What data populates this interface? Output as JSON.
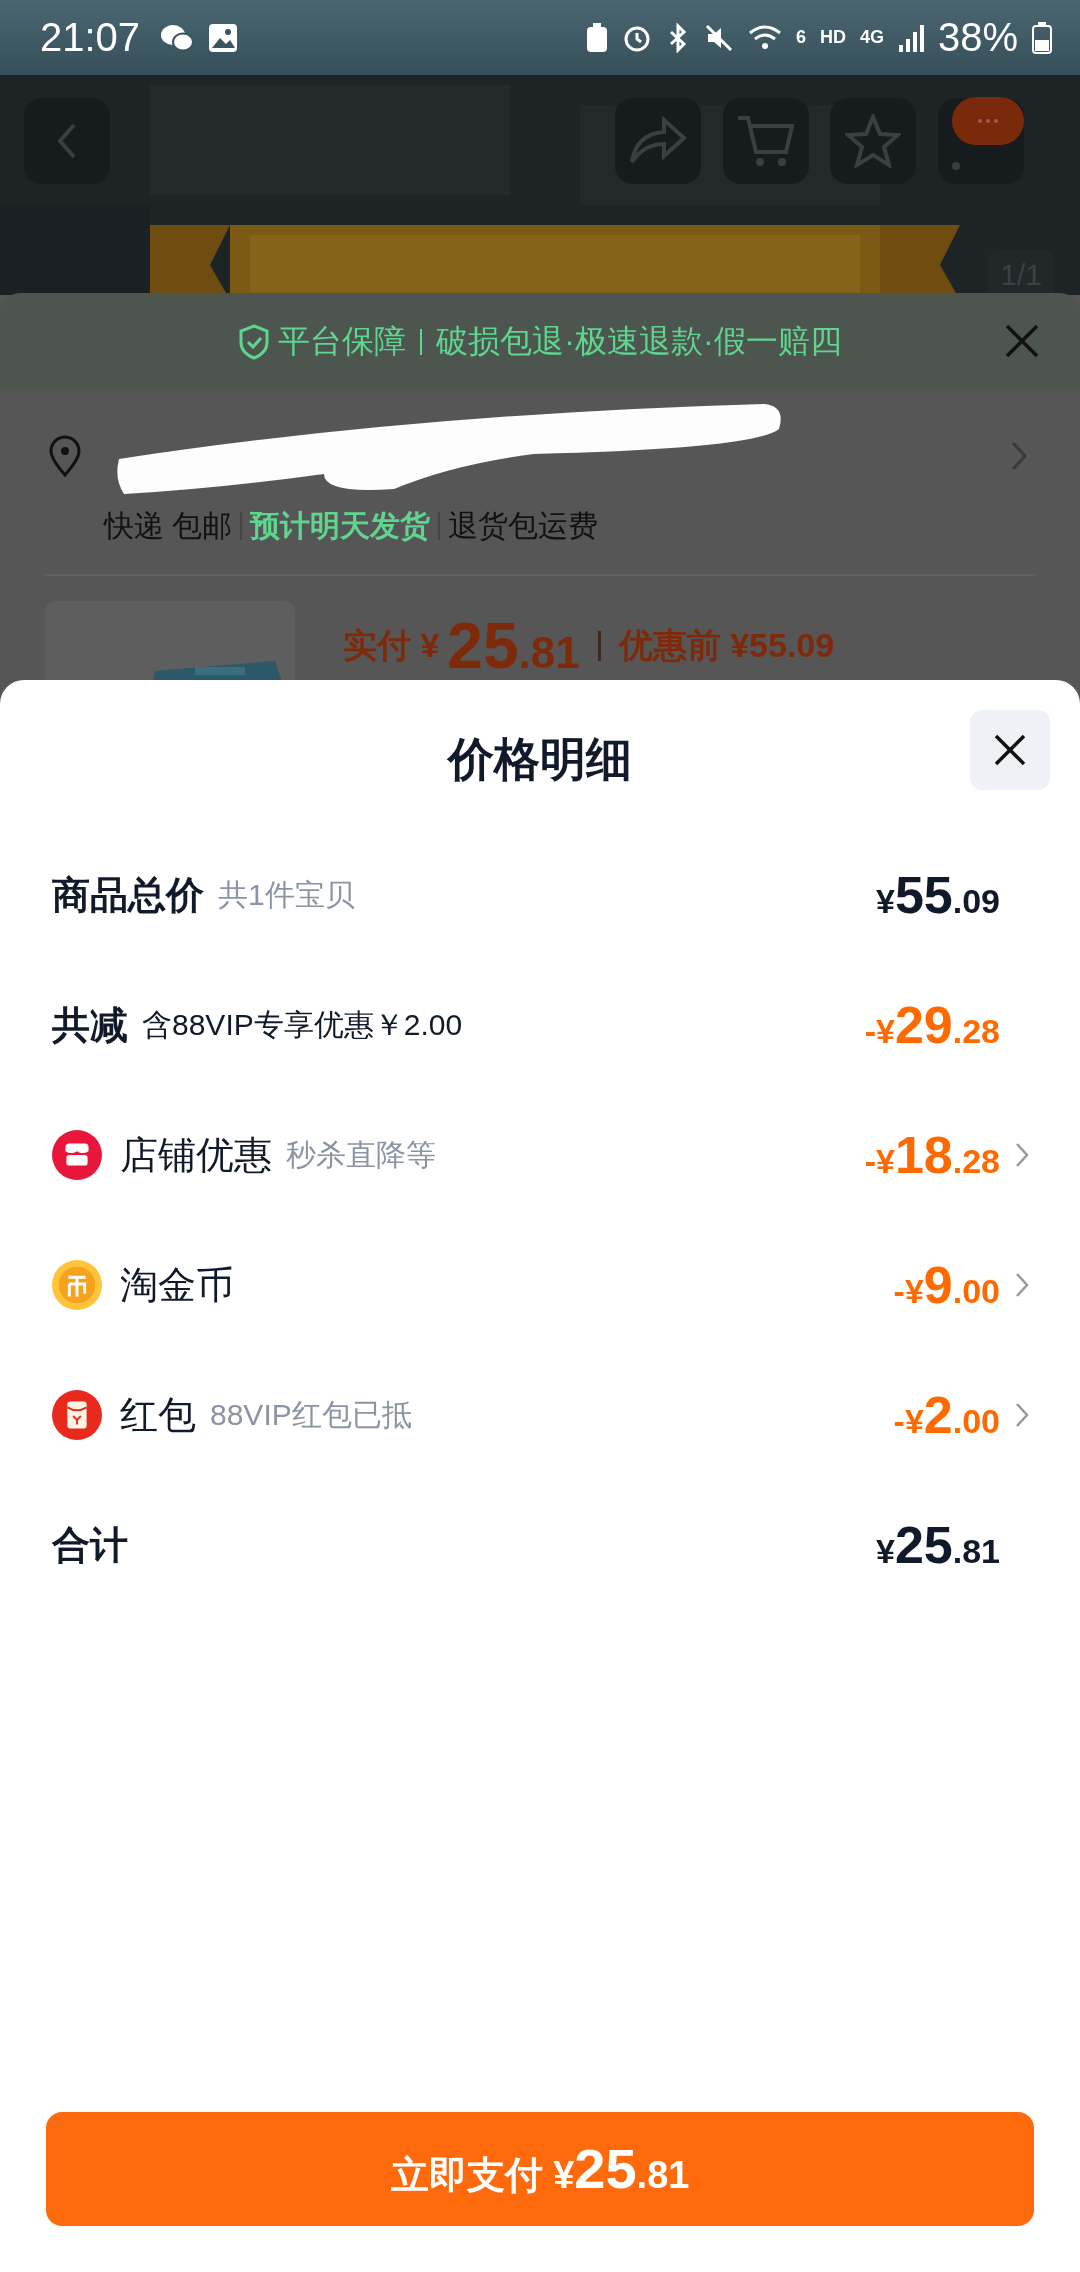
{
  "status_bar": {
    "time": "21:07",
    "wifi_label": "6",
    "hd_label": "HD",
    "network": "4G",
    "battery": "38%"
  },
  "header": {
    "image_counter": "1/1"
  },
  "order_sheet": {
    "guarantee": {
      "title": "平台保障",
      "items": "破损包退·极速退款·假一赔四"
    },
    "shipping": [
      {
        "text": "快递 包邮",
        "highlight": false
      },
      {
        "text": "预计明天发货",
        "highlight": true
      },
      {
        "text": "退货包运费",
        "highlight": false
      }
    ],
    "price": {
      "paid_label": "实付 ¥",
      "paid_int": "25",
      "paid_dec": ".81",
      "original": "优惠前 ¥55.09"
    }
  },
  "price_detail": {
    "title": "价格明细",
    "rows": [
      {
        "kind": "heading",
        "label": "商品总价",
        "note": "共1件宝贝",
        "prefix": "¥",
        "int": "55",
        "dec": ".09",
        "discount": false,
        "chevron": false
      },
      {
        "kind": "deduction",
        "label": "共减",
        "note": "含88VIP专享优惠￥2.00",
        "prefix": "-¥",
        "int": "29",
        "dec": ".28",
        "discount": true,
        "chevron": false
      },
      {
        "kind": "shop",
        "label": "店铺优惠",
        "note": "秒杀直降等",
        "prefix": "-¥",
        "int": "18",
        "dec": ".28",
        "discount": true,
        "chevron": true
      },
      {
        "kind": "coin",
        "label": "淘金币",
        "prefix": "-¥",
        "int": "9",
        "dec": ".00",
        "discount": true,
        "chevron": true
      },
      {
        "kind": "redpacket",
        "label": "红包",
        "note": "88VIP红包已抵",
        "prefix": "-¥",
        "int": "2",
        "dec": ".00",
        "discount": true,
        "chevron": true
      },
      {
        "kind": "heading",
        "label": "合计",
        "prefix": "¥",
        "int": "25",
        "dec": ".81",
        "discount": false,
        "chevron": false
      }
    ],
    "pay_button": {
      "label": "立即支付 ¥",
      "int": "25",
      "dec": ".81"
    }
  }
}
